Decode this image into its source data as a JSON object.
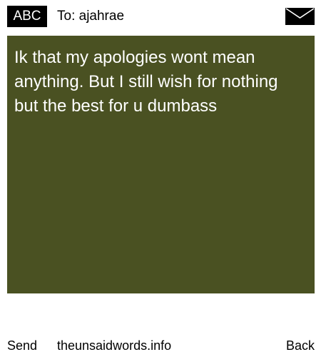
{
  "header": {
    "mode_label": "ABC",
    "recipient_label": "To: ajahrae",
    "envelope_icon": "envelope-icon"
  },
  "message": {
    "text": "Ik that my apologies wont mean anything. But I still wish for nothing but the best for u dumbass",
    "background_color": "#4a5122",
    "text_color": "#ffffff"
  },
  "footer": {
    "send_label": "Send",
    "site_label": "theunsaidwords.info",
    "back_label": "Back"
  }
}
